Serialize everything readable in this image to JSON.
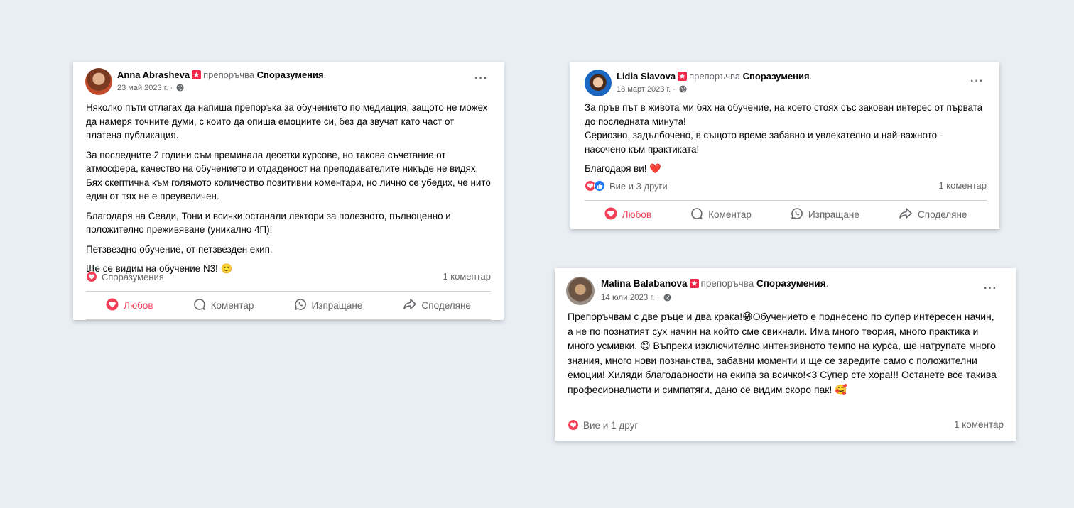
{
  "cards": [
    {
      "author": "Anna Abrasheva",
      "recommends": "препоръчва",
      "page": "Споразумения",
      "date": "23 май 2023 г.",
      "paragraphs": [
        "Няколко пъти отлагах да напиша препоръка за обучението по медиация, защото не можех да намеря точните думи, с които да опиша емоциите си, без да звучат като част от платена публикация.",
        "За последните 2 години съм преминала десетки курсове, но такова съчетание от атмосфера, качество на обучението и отдаденост на преподавателите никъде не видях. Бях скептична към голямото количество позитивни коментари, но лично се убедих, че нито един от тях не е преувеличен.",
        "Благодаря на Севди, Тони и всички останали лектори за полезното, пълноценно и положително преживяване (уникално 4П)!",
        "Петзвездно обучение, от петзвезден екип.",
        "Ще се видим на обучение N3! 🙂"
      ],
      "reactions_label": "Споразумения",
      "comments": "1 коментар",
      "actions": [
        "Любов",
        "Коментар",
        "Изпращане",
        "Споделяне"
      ]
    },
    {
      "author": "Lidia Slavova",
      "recommends": "препоръчва",
      "page": "Споразумения",
      "date": "18 март 2023 г.",
      "paragraphs": [
        "За пръв път в живота ми бях на обучение, на което стоях със закован интерес от първата до последната минута!\nСериозно, задълбочено, в същото време забавно и увлекателно и най-важното - насочено към практиката!",
        "Благодаря ви! ❤️"
      ],
      "reactions_label": "Вие и 3 други",
      "comments": "1 коментар",
      "actions": [
        "Любов",
        "Коментар",
        "Изпращане",
        "Споделяне"
      ]
    },
    {
      "author": "Malina Balabanova",
      "recommends": "препоръчва",
      "page": "Споразумения",
      "date": "14 юли 2023 г.",
      "paragraphs": [
        "Препоръчвам с две ръце и два крака!😁Обучението е поднесено по супер интересен начин, а не по познатият сух начин на който сме свикнали. Има много теория, много практика и много усмивки. 😊 Въпреки изключително интензивното темпо на курса, ще натрупате много знания, много нови познанства, забавни моменти и ще се заредите само с положителни емоции! Хиляди благодарности на екипа за всичко!<3 Супер сте хора!!! Останете все такива професионалисти и симпатяги, дано се видим скоро пак! 🥰"
      ],
      "reactions_label": "Вие и 1 друг",
      "comments": "1 коментар"
    }
  ]
}
